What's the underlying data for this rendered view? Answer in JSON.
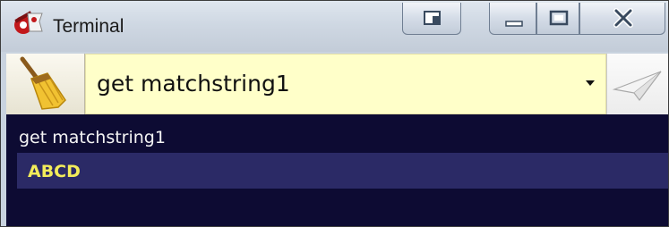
{
  "window": {
    "title": "Terminal",
    "icon": "terminal-gear-icon"
  },
  "caption_buttons": [
    {
      "name": "restore-side",
      "icon": "side-panel-icon"
    },
    {
      "name": "minimize",
      "icon": "minimize-icon"
    },
    {
      "name": "maximize",
      "icon": "maximize-icon"
    },
    {
      "name": "close",
      "icon": "close-icon"
    }
  ],
  "toolbar": {
    "clear_icon": "broom-icon",
    "command_value": "get matchstring1",
    "dropdown_icon": "chevron-down-icon",
    "send_icon": "paper-plane-icon"
  },
  "output": {
    "lines": [
      {
        "text": "get matchstring1",
        "color": "#f4f4f4"
      },
      {
        "text": "ABCD",
        "color": "#f2ec5a",
        "highlighted": true
      }
    ],
    "background": "#0d0b33",
    "highlight_color": "#2b2a66"
  }
}
